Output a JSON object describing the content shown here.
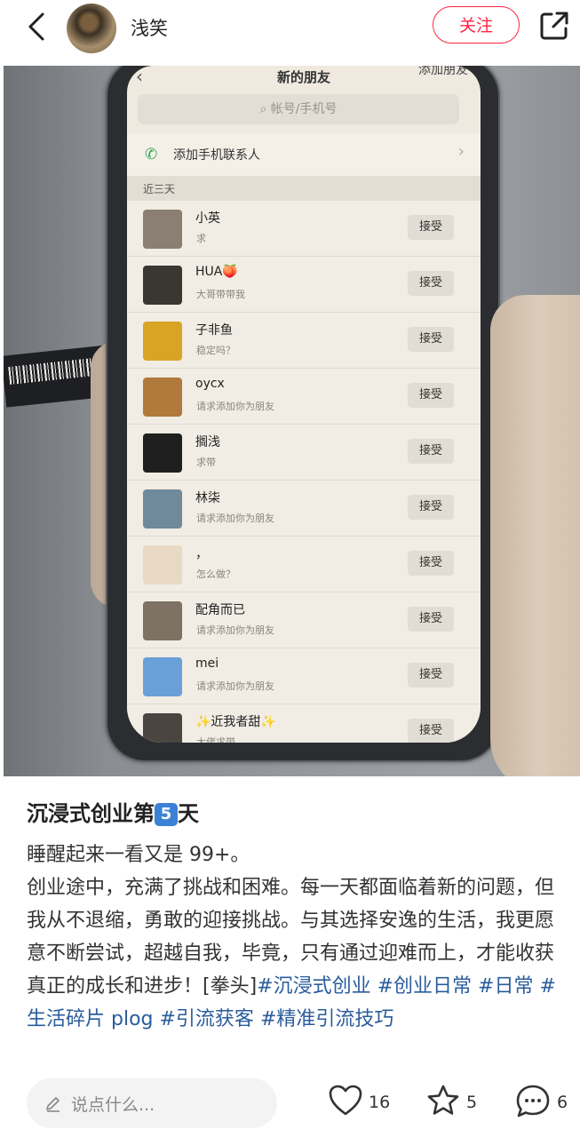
{
  "header": {
    "author_name": "浅笑",
    "follow_label": "关注"
  },
  "phone_screen": {
    "title": "新的朋友",
    "add_friend": "添加朋友",
    "search_placeholder": "帐号/手机号",
    "add_contacts": "添加手机联系人",
    "section_label": "近三天",
    "requests": [
      {
        "name": "小英",
        "message": "求",
        "accept": "接受",
        "avatar_color": "#8a7f72"
      },
      {
        "name": "HUA🍑",
        "message": "大哥带带我",
        "accept": "接受",
        "avatar_color": "#3a3632"
      },
      {
        "name": "子非鱼",
        "message": "稳定吗？",
        "accept": "接受",
        "avatar_color": "#d9a424"
      },
      {
        "name": "oycx",
        "message": "请求添加你为朋友",
        "accept": "接受",
        "avatar_color": "#b07a3c"
      },
      {
        "name": "搁浅",
        "message": "求带",
        "accept": "接受",
        "avatar_color": "#1f1f1f"
      },
      {
        "name": "林柒",
        "message": "请求添加你为朋友",
        "accept": "接受",
        "avatar_color": "#6f8a9a"
      },
      {
        "name": "，",
        "message": "怎么做？",
        "accept": "接受",
        "avatar_color": "#e8d9c4"
      },
      {
        "name": "配角而已",
        "message": "请求添加你为朋友",
        "accept": "接受",
        "avatar_color": "#7d7264"
      },
      {
        "name": "mei",
        "message": "请求添加你为朋友",
        "accept": "接受",
        "avatar_color": "#6aa0d8"
      },
      {
        "name": "✨近我者甜✨",
        "message": "大佬求带",
        "accept": "接受",
        "avatar_color": "#4a4540"
      }
    ]
  },
  "post": {
    "title": "沉浸式创业第",
    "title_num": "5",
    "title_suffix": "天",
    "line1": "睡醒起来一看又是 99+。",
    "paragraph": "创业途中，充满了挑战和困难。每一天都面临着新的问题，但我从不退缩，勇敢的迎接挑战。与其选择安逸的生活，我更愿意不断尝试，超越自我，毕竟，只有通过迎难而上，才能收获真正的成长和进步！[拳头]",
    "tags": [
      "#沉浸式创业",
      "#创业日常",
      "#日常",
      "#生活碎片 plog",
      "#引流获客",
      "#精准引流技巧"
    ]
  },
  "bottom": {
    "comment_placeholder": "说点什么...",
    "likes": "16",
    "collects": "5",
    "comments": "6"
  },
  "colors": {
    "accent": "#ff2442",
    "tag": "#2a5c9c"
  }
}
